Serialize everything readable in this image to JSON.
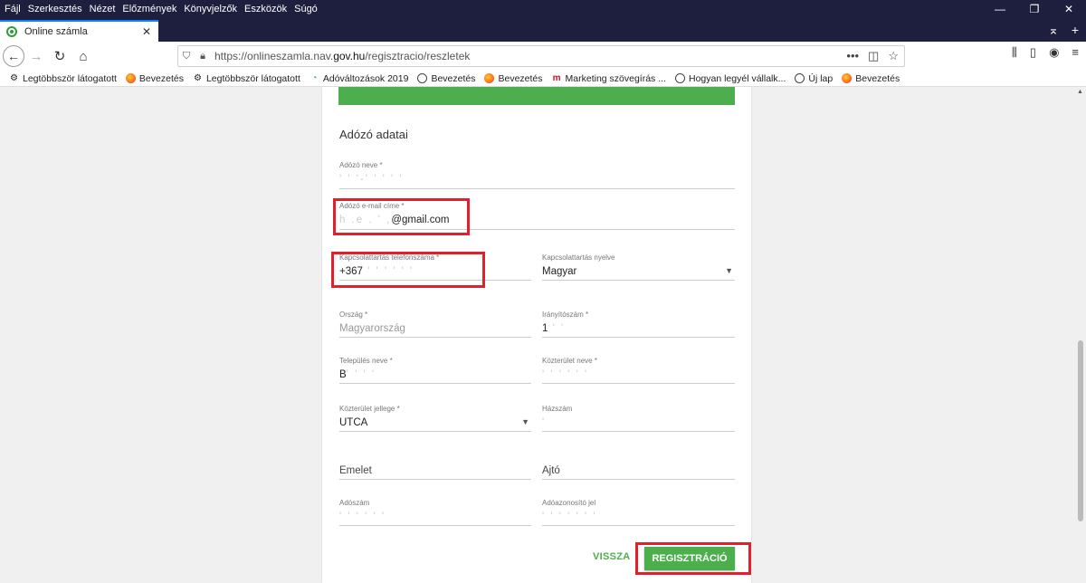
{
  "menu": [
    "Fájl",
    "Szerkesztés",
    "Nézet",
    "Előzmények",
    "Könyvjelzők",
    "Eszközök",
    "Súgó"
  ],
  "tab": {
    "title": "Online számla",
    "close": "✕"
  },
  "window_controls": {
    "minimize": "—",
    "restore": "❐",
    "close": "✕"
  },
  "tab_tools": {
    "overflow": "⌅",
    "new_tab": "+"
  },
  "url": {
    "prefix": "https://onlineszamla.nav.",
    "domain": "gov.hu",
    "path": "/regisztracio/reszletek"
  },
  "bookmarks": [
    {
      "label": "Legtöbbször látogatott",
      "icon": "gear-icon"
    },
    {
      "label": "Bevezetés",
      "icon": "firefox-icon"
    },
    {
      "label": "Legtöbbször látogatott",
      "icon": "gear-icon"
    },
    {
      "label": "Adóváltozások 2019",
      "icon": "chart-icon"
    },
    {
      "label": "Bevezetés",
      "icon": "globe-icon"
    },
    {
      "label": "Bevezetés",
      "icon": "firefox-icon"
    },
    {
      "label": "Marketing szövegírás ...",
      "icon": "m-icon"
    },
    {
      "label": "Hogyan legyél vállalk...",
      "icon": "globe-icon"
    },
    {
      "label": "Új lap",
      "icon": "globe-icon"
    },
    {
      "label": "Bevezetés",
      "icon": "firefox-icon"
    }
  ],
  "form": {
    "section_title": "Adózó adatai",
    "name": {
      "label": "Adózó neve *",
      "value": "' ' '-' ' ' ' '"
    },
    "email": {
      "label": "Adózó e-mail címe *",
      "value_hidden": "h  .e . ' ,",
      "value_visible": "@gmail.com"
    },
    "phone": {
      "label": "Kapcsolattartás telefonszáma *",
      "value_visible": "+367",
      "value_hidden": " ' ' ' ' ' ' "
    },
    "language": {
      "label": "Kapcsolattartás nyelve",
      "value": "Magyar"
    },
    "country": {
      "label": "Ország *",
      "value": "Magyarország"
    },
    "zip": {
      "label": "Irányítószám *",
      "value_visible": "1",
      "value_hidden": " ' '"
    },
    "city": {
      "label": "Település neve *",
      "value_visible": "B",
      "value_hidden": "' ' ' '"
    },
    "street": {
      "label": "Közterület neve *",
      "value_hidden": "' ' ' ' ' '"
    },
    "street_type": {
      "label": "Közterület jellege *",
      "value": "UTCA"
    },
    "house_number": {
      "label": "Házszám",
      "value_hidden": "'"
    },
    "floor": {
      "placeholder": "Emelet"
    },
    "door": {
      "placeholder": "Ajtó"
    },
    "tax_number": {
      "label": "Adószám",
      "value_hidden": "' ' ' ' ' '"
    },
    "tax_id": {
      "label": "Adóazonosító jel",
      "value_hidden": "' ' ' ' ' ' '"
    },
    "back_label": "VISSZA",
    "register_label": "REGISZTRÁCIÓ"
  },
  "colors": {
    "accent_green": "#4cae4c",
    "highlight_red": "#e0202a",
    "chrome_dark": "#1e1f3e"
  }
}
